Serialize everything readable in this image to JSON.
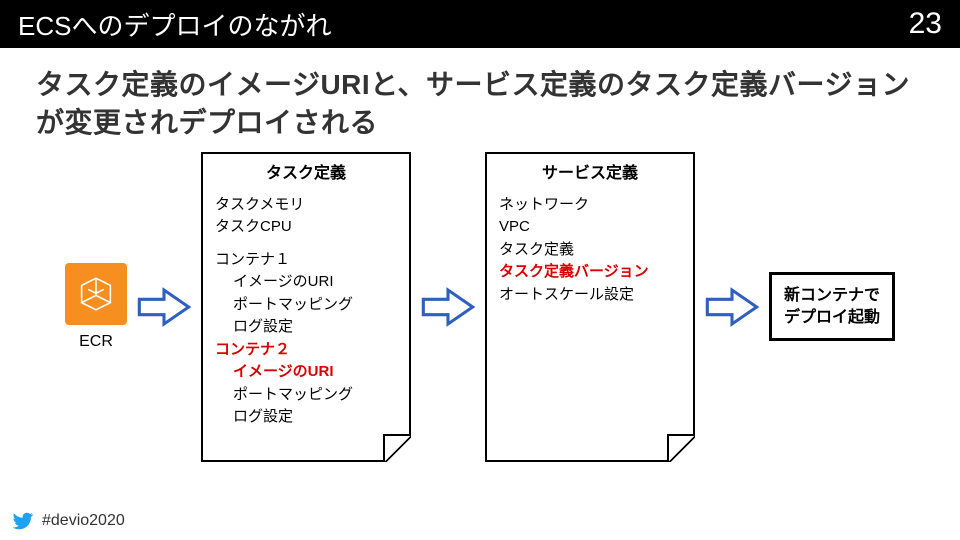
{
  "header": {
    "title": "ECSへのデプロイのながれ",
    "page": "23"
  },
  "subhead": "タスク定義のイメージURIと、サービス定義のタスク定義バージョンが変更されデプロイされる",
  "ecr": {
    "label": "ECR"
  },
  "taskdef": {
    "title": "タスク定義",
    "lines": {
      "memory": "タスクメモリ",
      "cpu": "タスクCPU",
      "c1": "コンテナ１",
      "c1_uri": "イメージのURI",
      "c1_port": "ポートマッピング",
      "c1_log": "ログ設定",
      "c2": "コンテナ２",
      "c2_uri": "イメージのURI",
      "c2_port": "ポートマッピング",
      "c2_log": "ログ設定"
    }
  },
  "servicedef": {
    "title": "サービス定義",
    "lines": {
      "net": "ネットワーク",
      "vpc": "VPC",
      "task": "タスク定義",
      "taskver": "タスク定義バージョン",
      "as": "オートスケール設定"
    }
  },
  "result": {
    "line1": "新コンテナで",
    "line2": "デプロイ起動"
  },
  "footer": {
    "hashtag": "#devio2020"
  }
}
